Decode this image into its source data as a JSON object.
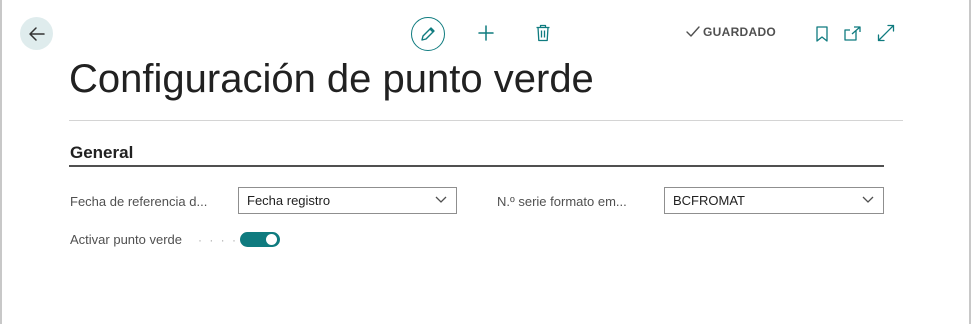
{
  "header": {
    "back_icon": "arrow-left-icon",
    "edit_icon": "pencil-icon",
    "add_icon": "plus-icon",
    "delete_icon": "trash-icon",
    "saved_label": "GUARDADO",
    "saved_icon": "checkmark-icon",
    "bookmark_icon": "bookmark-icon",
    "open_new_window_icon": "open-new-window-icon",
    "expand_icon": "expand-icon",
    "accent_color": "#0f7b7f"
  },
  "page": {
    "title": "Configuración de punto verde"
  },
  "section": {
    "title": "General",
    "fields": {
      "reference_date": {
        "label": "Fecha de referencia d...",
        "value": "Fecha registro"
      },
      "series_format": {
        "label": "N.º serie formato em...",
        "value": "BCFROMAT"
      },
      "activate": {
        "label": "Activar punto verde",
        "value": true
      }
    }
  }
}
